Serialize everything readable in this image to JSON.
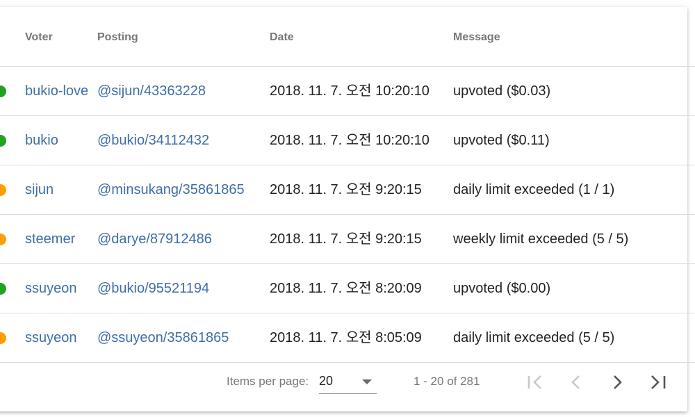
{
  "table": {
    "columns": {
      "voter": "Voter",
      "posting": "Posting",
      "date": "Date",
      "message": "Message"
    },
    "rows": [
      {
        "status_color": "#21a321",
        "voter": "bukio-love",
        "posting": "@sijun/43363228",
        "date": "2018. 11. 7. 오전 10:20:10",
        "message": "upvoted ($0.03)"
      },
      {
        "status_color": "#21a321",
        "voter": "bukio",
        "posting": "@bukio/34112432",
        "date": "2018. 11. 7. 오전 10:20:10",
        "message": "upvoted ($0.11)"
      },
      {
        "status_color": "#ffa000",
        "voter": "sijun",
        "posting": "@minsukang/35861865",
        "date": "2018. 11. 7. 오전 9:20:15",
        "message": "daily limit exceeded (1 / 1)"
      },
      {
        "status_color": "#ffa000",
        "voter": "steemer",
        "posting": "@darye/87912486",
        "date": "2018. 11. 7. 오전 9:20:15",
        "message": "weekly limit exceeded (5 / 5)"
      },
      {
        "status_color": "#21a321",
        "voter": "ssuyeon",
        "posting": "@bukio/95521194",
        "date": "2018. 11. 7. 오전 8:20:09",
        "message": "upvoted ($0.00)"
      },
      {
        "status_color": "#ffa000",
        "voter": "ssuyeon",
        "posting": "@ssuyeon/35861865",
        "date": "2018. 11. 7. 오전 8:05:09",
        "message": "daily limit exceeded (5 / 5)"
      }
    ]
  },
  "paginator": {
    "items_per_page_label": "Items per page:",
    "items_per_page_value": "20",
    "range_label": "1 - 20 of 281",
    "icons": {
      "first": "first-page-icon",
      "previous": "chevron-left-icon",
      "next": "chevron-right-icon",
      "last": "last-page-icon"
    }
  },
  "colors": {
    "link": "#3d6ea6",
    "success": "#21a321",
    "warning": "#ffa000"
  }
}
